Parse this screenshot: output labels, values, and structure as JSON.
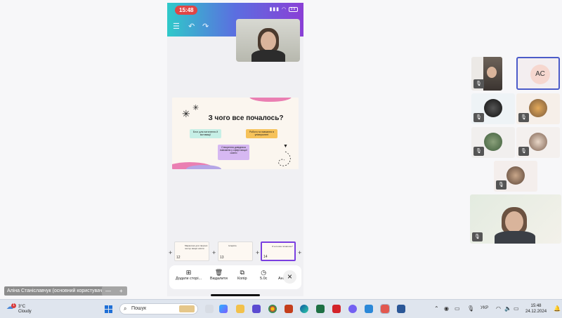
{
  "phone": {
    "status_time": "15:48",
    "battery": "59",
    "slide": {
      "title": "З чого все почалось?",
      "box_a": "Блог для натхнення й мотивації",
      "box_b": "Робота та навчання в університеті",
      "box_c": "Створення довідника навчання у сфері вищої освіти"
    },
    "thumbnails": [
      {
        "num": "12",
        "text": "Маркетинг для творчих послуг вищої освіти"
      },
      {
        "num": "13",
        "text": "Інтерв'ю"
      },
      {
        "num": "14",
        "text": "З чого все почалось?"
      }
    ],
    "bottom_bar": {
      "add_page": "Додати сторі...",
      "delete": "Видалити",
      "copy": "Копір",
      "duration": "5.0с",
      "anim": "Ані"
    }
  },
  "participants": {
    "avatar_initials": "АС"
  },
  "name_label": "Аліна Станіславчук (основний користувач)",
  "zoom": {
    "minus": "—",
    "plus": "+"
  },
  "taskbar": {
    "weather_temp": "3°C",
    "weather_cond": "Cloudy",
    "weather_badge": "1",
    "search_placeholder": "Пошук",
    "lang": "УКР",
    "time": "15:48",
    "date": "24.12.2024"
  },
  "colors": {
    "accent_purple": "#7a3fe0",
    "slide_pink": "#ea7fb2",
    "toolbar_start": "#2fc9c9",
    "toolbar_end": "#8a3fd6"
  }
}
